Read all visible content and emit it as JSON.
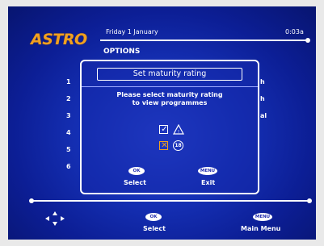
{
  "header": {
    "logo": "ASTRO",
    "date": "Friday 1 January",
    "time": "0:03a",
    "section": "OPTIONS"
  },
  "background_rows": {
    "numbers": [
      "1",
      "2",
      "3",
      "4",
      "5",
      "6"
    ],
    "right_items": [
      "h",
      "h",
      "al"
    ]
  },
  "dialog": {
    "title": "Set maturity rating",
    "message_line1": "Please select maturity rating",
    "message_line2": "to view programmes",
    "options": [
      {
        "icon": "warning-triangle-icon",
        "state": "checked"
      },
      {
        "icon": "rating-18-icon",
        "rating": "18",
        "state": "crossed"
      }
    ],
    "buttons": {
      "select_key": "OK",
      "select_label": "Select",
      "exit_key": "MENU",
      "exit_label": "Exit"
    }
  },
  "footer": {
    "nav_icon": "direction-arrows-icon",
    "select_key": "OK",
    "select_label": "Select",
    "menu_key": "MENU",
    "menu_label": "Main Menu"
  },
  "colors": {
    "background": "#1530b5",
    "accent_orange": "#f0a020",
    "frame": "#e9e9e9"
  }
}
